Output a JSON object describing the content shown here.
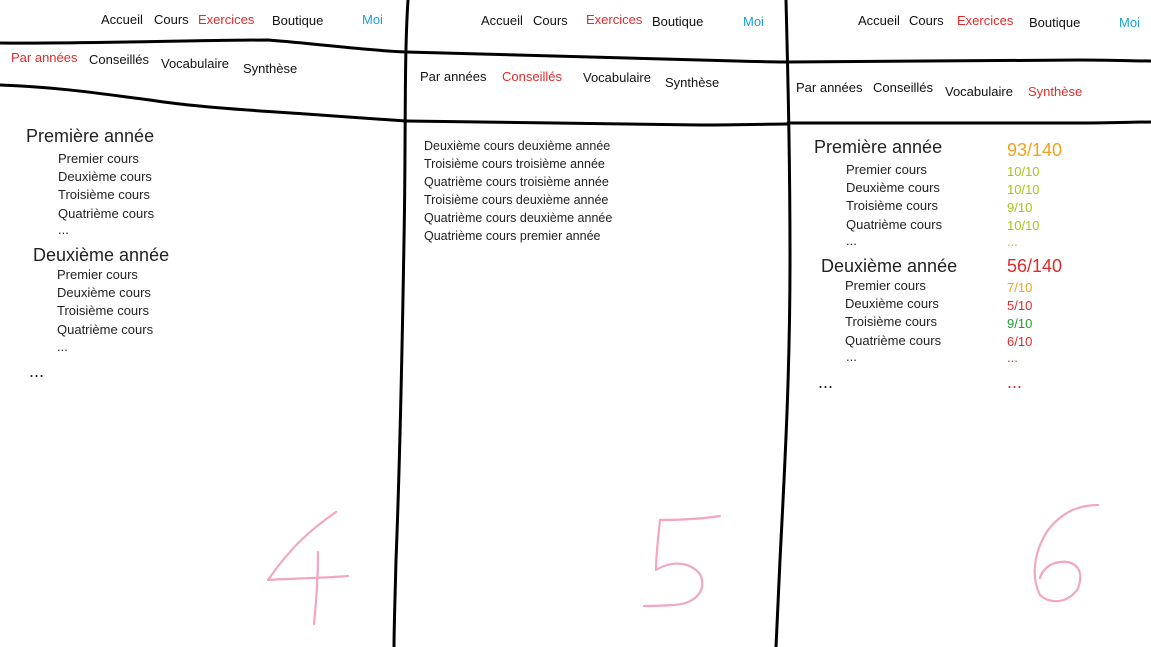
{
  "nav": {
    "items": [
      "Accueil",
      "Cours",
      "Exercices",
      "Boutique"
    ],
    "user": "Moi"
  },
  "subnav": [
    "Par années",
    "Conseillés",
    "Vocabulaire",
    "Synthèse"
  ],
  "panel4": {
    "years": [
      {
        "title": "Première année",
        "courses": [
          "Premier cours",
          "Deuxième cours",
          "Troisième cours",
          "Quatrième cours"
        ],
        "more": "..."
      },
      {
        "title": "Deuxième année",
        "courses": [
          "Premier cours",
          "Deuxième cours",
          "Troisième cours",
          "Quatrième cours"
        ],
        "more": "..."
      }
    ],
    "more": "...",
    "number": "4"
  },
  "panel5": {
    "recommended": [
      "Deuxième cours deuxième année",
      "Troisième cours troisième année",
      "Quatrième cours troisième année",
      "Troisième cours deuxième année",
      "Quatrième cours deuxième année",
      "Quatrième cours premier année"
    ],
    "number": "5"
  },
  "panel6": {
    "years": [
      {
        "title": "Première année",
        "score": "93/140",
        "courses": [
          "Premier cours",
          "Deuxième cours",
          "Troisième cours",
          "Quatrième cours"
        ],
        "scores": [
          "10/10",
          "10/10",
          "9/10",
          "10/10"
        ],
        "more": "...",
        "more_score": "..."
      },
      {
        "title": "Deuxième année",
        "score": "56/140",
        "courses": [
          "Premier cours",
          "Deuxième cours",
          "Troisième cours",
          "Quatrième cours"
        ],
        "scores": [
          "7/10",
          "5/10",
          "9/10",
          "6/10"
        ],
        "more": "...",
        "more_score": "..."
      }
    ],
    "more": "...",
    "more_score": "...",
    "number": "6"
  },
  "colors": {
    "active": "#e12a2a",
    "user": "#1aa0d8",
    "annotation": "#f2a6c4"
  }
}
